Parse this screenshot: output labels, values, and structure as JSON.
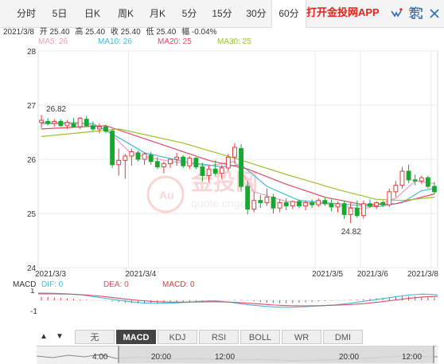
{
  "tabs": [
    {
      "label": "分时",
      "active": false
    },
    {
      "label": "5日",
      "active": false
    },
    {
      "label": "日K",
      "active": false
    },
    {
      "label": "周K",
      "active": false
    },
    {
      "label": "月K",
      "active": false
    },
    {
      "label": "5分",
      "active": false
    },
    {
      "label": "15分",
      "active": false
    },
    {
      "label": "30分",
      "active": false
    },
    {
      "label": "60分",
      "active": true
    }
  ],
  "promo": {
    "label": "打开金投网APP"
  },
  "icons": {
    "wechat": "weixin-icon",
    "strategy": "策",
    "fullscreen": "fullscreen-icon",
    "close": "close-icon"
  },
  "info": {
    "date": "2021/3/8",
    "open": "开 25.40",
    "high": "高 25.40",
    "close": "收 25.40",
    "low": "低 25.40",
    "change": "幅 -0.04%"
  },
  "ma_legend": [
    {
      "label": "MA5: 26",
      "color": "#f29bbd"
    },
    {
      "label": "MA10: 26",
      "color": "#3fbbd9"
    },
    {
      "label": "MA20: 25",
      "color": "#e04a64"
    },
    {
      "label": "MA30: 25",
      "color": "#9ac22b"
    }
  ],
  "macd_legend": {
    "title": "MACD",
    "dif": "DIF: 0",
    "dea": "DEA: 0",
    "macd": "MACD: 0"
  },
  "indicators": [
    {
      "label": "无",
      "active": false
    },
    {
      "label": "MACD",
      "active": true
    },
    {
      "label": "KDJ",
      "active": false
    },
    {
      "label": "RSI",
      "active": false
    },
    {
      "label": "BOLL",
      "active": false
    },
    {
      "label": "WR",
      "active": false
    },
    {
      "label": "DMI",
      "active": false
    }
  ],
  "navigator": {
    "labels": [
      "4:00",
      "20:00",
      "12:00",
      "20:00",
      "12:00"
    ]
  },
  "watermark": {
    "text": "金投网",
    "url": "quote.cngold.org"
  },
  "colors": {
    "up": "#e23b3b",
    "down": "#18a832",
    "accent": "#e1241c"
  },
  "chart_data": {
    "type": "candlestick",
    "ylim": [
      24,
      28
    ],
    "y_ticks": [
      "28",
      "27",
      "26",
      "25",
      "24"
    ],
    "x_labels": [
      "2021/3/3",
      "2021/3/4",
      "2021/3/5",
      "2021/3/6",
      "2021/3/8"
    ],
    "annotations": [
      "26.82",
      "24.82"
    ],
    "candles": [
      {
        "o": 26.68,
        "h": 26.82,
        "l": 26.58,
        "c": 26.72
      },
      {
        "o": 26.7,
        "h": 26.76,
        "l": 26.62,
        "c": 26.66
      },
      {
        "o": 26.66,
        "h": 26.74,
        "l": 26.6,
        "c": 26.7
      },
      {
        "o": 26.7,
        "h": 26.74,
        "l": 26.6,
        "c": 26.62
      },
      {
        "o": 26.62,
        "h": 26.72,
        "l": 26.56,
        "c": 26.68
      },
      {
        "o": 26.66,
        "h": 26.76,
        "l": 26.58,
        "c": 26.6
      },
      {
        "o": 26.6,
        "h": 26.78,
        "l": 26.56,
        "c": 26.76
      },
      {
        "o": 26.74,
        "h": 26.8,
        "l": 26.6,
        "c": 26.62
      },
      {
        "o": 26.62,
        "h": 26.7,
        "l": 26.52,
        "c": 26.56
      },
      {
        "o": 26.56,
        "h": 26.66,
        "l": 26.48,
        "c": 26.6
      },
      {
        "o": 26.6,
        "h": 26.64,
        "l": 26.48,
        "c": 26.52
      },
      {
        "o": 26.52,
        "h": 26.56,
        "l": 25.84,
        "c": 25.9
      },
      {
        "o": 25.9,
        "h": 26.2,
        "l": 25.7,
        "c": 25.98
      },
      {
        "o": 25.98,
        "h": 26.1,
        "l": 25.64,
        "c": 26.06
      },
      {
        "o": 26.06,
        "h": 26.2,
        "l": 25.88,
        "c": 26.14
      },
      {
        "o": 26.12,
        "h": 26.16,
        "l": 25.96,
        "c": 26.0
      },
      {
        "o": 26.0,
        "h": 26.12,
        "l": 25.9,
        "c": 26.1
      },
      {
        "o": 26.08,
        "h": 26.14,
        "l": 25.9,
        "c": 25.96
      },
      {
        "o": 25.96,
        "h": 26.04,
        "l": 25.82,
        "c": 25.86
      },
      {
        "o": 25.86,
        "h": 25.96,
        "l": 25.74,
        "c": 25.92
      },
      {
        "o": 25.92,
        "h": 26.0,
        "l": 25.84,
        "c": 26.0
      },
      {
        "o": 26.0,
        "h": 26.12,
        "l": 25.88,
        "c": 26.04
      },
      {
        "o": 26.04,
        "h": 26.08,
        "l": 25.84,
        "c": 25.88
      },
      {
        "o": 25.88,
        "h": 26.06,
        "l": 25.82,
        "c": 26.02
      },
      {
        "o": 26.02,
        "h": 26.04,
        "l": 25.82,
        "c": 25.86
      },
      {
        "o": 25.86,
        "h": 25.94,
        "l": 25.6,
        "c": 25.7
      },
      {
        "o": 25.7,
        "h": 25.88,
        "l": 25.58,
        "c": 25.82
      },
      {
        "o": 25.82,
        "h": 25.98,
        "l": 25.7,
        "c": 25.74
      },
      {
        "o": 25.74,
        "h": 25.9,
        "l": 25.64,
        "c": 25.84
      },
      {
        "o": 25.84,
        "h": 26.1,
        "l": 25.78,
        "c": 26.04
      },
      {
        "o": 26.04,
        "h": 26.3,
        "l": 25.92,
        "c": 26.22
      },
      {
        "o": 26.2,
        "h": 26.28,
        "l": 25.4,
        "c": 25.5
      },
      {
        "o": 25.5,
        "h": 25.6,
        "l": 24.98,
        "c": 25.08
      },
      {
        "o": 25.08,
        "h": 25.4,
        "l": 25.02,
        "c": 25.24
      },
      {
        "o": 25.24,
        "h": 25.34,
        "l": 25.1,
        "c": 25.2
      },
      {
        "o": 25.2,
        "h": 25.46,
        "l": 25.14,
        "c": 25.3
      },
      {
        "o": 25.3,
        "h": 25.36,
        "l": 25.0,
        "c": 25.1
      },
      {
        "o": 25.1,
        "h": 25.26,
        "l": 25.02,
        "c": 25.2
      },
      {
        "o": 25.2,
        "h": 25.28,
        "l": 25.06,
        "c": 25.14
      },
      {
        "o": 25.14,
        "h": 25.24,
        "l": 25.08,
        "c": 25.22
      },
      {
        "o": 25.22,
        "h": 25.26,
        "l": 25.1,
        "c": 25.14
      },
      {
        "o": 25.14,
        "h": 25.24,
        "l": 25.06,
        "c": 25.2
      },
      {
        "o": 25.2,
        "h": 25.26,
        "l": 25.1,
        "c": 25.16
      },
      {
        "o": 25.16,
        "h": 25.28,
        "l": 25.12,
        "c": 25.24
      },
      {
        "o": 25.24,
        "h": 25.3,
        "l": 25.14,
        "c": 25.18
      },
      {
        "o": 25.18,
        "h": 25.26,
        "l": 25.04,
        "c": 25.12
      },
      {
        "o": 25.12,
        "h": 25.22,
        "l": 25.02,
        "c": 25.18
      },
      {
        "o": 25.18,
        "h": 25.24,
        "l": 24.9,
        "c": 24.98
      },
      {
        "o": 24.98,
        "h": 25.2,
        "l": 24.82,
        "c": 25.1
      },
      {
        "o": 25.1,
        "h": 25.24,
        "l": 24.92,
        "c": 24.96
      },
      {
        "o": 24.96,
        "h": 25.24,
        "l": 24.9,
        "c": 25.18
      },
      {
        "o": 25.18,
        "h": 25.26,
        "l": 25.1,
        "c": 25.14
      },
      {
        "o": 25.14,
        "h": 25.22,
        "l": 25.08,
        "c": 25.2
      },
      {
        "o": 25.2,
        "h": 25.24,
        "l": 25.12,
        "c": 25.16
      },
      {
        "o": 25.16,
        "h": 25.46,
        "l": 25.12,
        "c": 25.4
      },
      {
        "o": 25.4,
        "h": 25.6,
        "l": 25.3,
        "c": 25.52
      },
      {
        "o": 25.52,
        "h": 25.86,
        "l": 25.46,
        "c": 25.78
      },
      {
        "o": 25.78,
        "h": 25.9,
        "l": 25.56,
        "c": 25.62
      },
      {
        "o": 25.62,
        "h": 25.72,
        "l": 25.52,
        "c": 25.6
      },
      {
        "o": 25.6,
        "h": 25.7,
        "l": 25.54,
        "c": 25.66
      },
      {
        "o": 25.66,
        "h": 25.7,
        "l": 25.46,
        "c": 25.5
      },
      {
        "o": 25.5,
        "h": 25.58,
        "l": 25.36,
        "c": 25.4
      }
    ],
    "ma": [
      {
        "name": "MA5",
        "color": "#f29bbd",
        "points": [
          [
            0,
            26.68
          ],
          [
            6,
            26.68
          ],
          [
            10,
            26.56
          ],
          [
            14,
            26.1
          ],
          [
            20,
            25.96
          ],
          [
            26,
            25.88
          ],
          [
            30,
            25.96
          ],
          [
            33,
            25.4
          ],
          [
            38,
            25.22
          ],
          [
            44,
            25.18
          ],
          [
            50,
            25.08
          ],
          [
            55,
            25.28
          ],
          [
            58,
            25.6
          ],
          [
            61,
            25.55
          ]
        ]
      },
      {
        "name": "MA10",
        "color": "#3fbbd9",
        "points": [
          [
            0,
            26.66
          ],
          [
            8,
            26.66
          ],
          [
            12,
            26.4
          ],
          [
            16,
            26.12
          ],
          [
            22,
            25.96
          ],
          [
            28,
            25.86
          ],
          [
            31,
            25.9
          ],
          [
            35,
            25.5
          ],
          [
            40,
            25.24
          ],
          [
            46,
            25.18
          ],
          [
            52,
            25.12
          ],
          [
            56,
            25.2
          ],
          [
            59,
            25.42
          ],
          [
            61,
            25.46
          ]
        ]
      },
      {
        "name": "MA20",
        "color": "#e04a64",
        "points": [
          [
            0,
            26.56
          ],
          [
            10,
            26.62
          ],
          [
            18,
            26.3
          ],
          [
            26,
            25.98
          ],
          [
            32,
            25.82
          ],
          [
            38,
            25.54
          ],
          [
            44,
            25.3
          ],
          [
            50,
            25.16
          ],
          [
            55,
            25.18
          ],
          [
            61,
            25.36
          ]
        ]
      },
      {
        "name": "MA30",
        "color": "#9ac22b",
        "points": [
          [
            0,
            26.42
          ],
          [
            12,
            26.56
          ],
          [
            22,
            26.3
          ],
          [
            30,
            26.02
          ],
          [
            38,
            25.72
          ],
          [
            46,
            25.44
          ],
          [
            52,
            25.26
          ],
          [
            56,
            25.24
          ],
          [
            61,
            25.3
          ]
        ]
      }
    ],
    "macd": {
      "ylim": [
        -1,
        1
      ],
      "y_ticks": [
        "1",
        "-1"
      ],
      "hist": [
        0.32,
        0.3,
        0.26,
        0.22,
        0.18,
        0.14,
        0.1,
        0.06,
        0.02,
        -0.02,
        -0.06,
        -0.12,
        -0.18,
        -0.24,
        -0.28,
        -0.3,
        -0.3,
        -0.28,
        -0.26,
        -0.24,
        -0.22,
        -0.2,
        -0.18,
        -0.16,
        -0.12,
        -0.1,
        -0.06,
        -0.04,
        -0.02,
        0.02,
        0.05,
        0.04,
        -0.04,
        -0.1,
        -0.16,
        -0.22,
        -0.26,
        -0.3,
        -0.3,
        -0.28,
        -0.24,
        -0.2,
        -0.16,
        -0.12,
        -0.08,
        -0.04,
        -0.02,
        0.02,
        0.05,
        0.08,
        0.12,
        0.16,
        0.2,
        0.24,
        0.28,
        0.32,
        0.36,
        0.38,
        0.36,
        0.32,
        0.28,
        0.24
      ],
      "dif": [
        0.7,
        0.68,
        0.62,
        0.5,
        0.3,
        0.1,
        -0.1,
        -0.25,
        -0.3,
        -0.28,
        -0.2,
        -0.1,
        -0.05,
        -0.2,
        -0.4,
        -0.55,
        -0.65,
        -0.68,
        -0.62,
        -0.55,
        -0.45,
        -0.3,
        -0.1,
        0.1,
        0.3,
        0.5,
        0.6,
        0.52
      ],
      "dea": [
        0.62,
        0.62,
        0.6,
        0.54,
        0.42,
        0.28,
        0.1,
        -0.04,
        -0.14,
        -0.18,
        -0.18,
        -0.16,
        -0.14,
        -0.18,
        -0.26,
        -0.36,
        -0.46,
        -0.52,
        -0.54,
        -0.52,
        -0.48,
        -0.42,
        -0.32,
        -0.18,
        0.0,
        0.18,
        0.32,
        0.38
      ]
    }
  }
}
